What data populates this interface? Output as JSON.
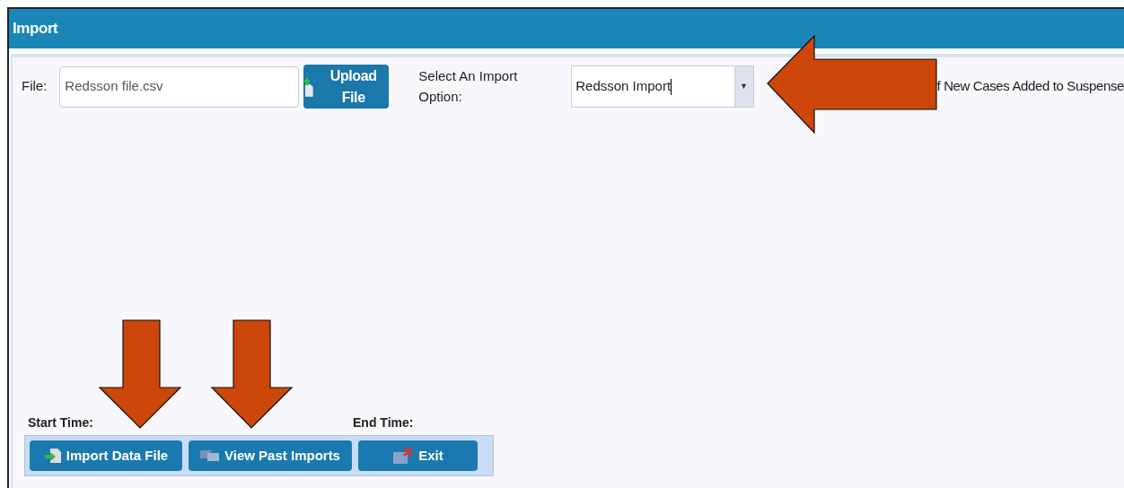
{
  "window": {
    "title": "Import"
  },
  "file": {
    "label": "File:",
    "value": "Redsson file.csv",
    "button": "Upload File"
  },
  "import_option": {
    "label": "Select An Import Option:",
    "value": "Redsson Import",
    "arrow": "▼"
  },
  "note": "f New Cases Added to Suspense",
  "times": {
    "start_label": "Start Time:",
    "end_label": "End Time:"
  },
  "buttons": [
    {
      "kind": "import",
      "label": "Import Data File"
    },
    {
      "kind": "history",
      "label": "View Past Imports"
    },
    {
      "kind": "exit",
      "label": "Exit"
    }
  ],
  "annotations": [
    {
      "kind": "left"
    },
    {
      "kind": "down"
    },
    {
      "kind": "down"
    }
  ]
}
